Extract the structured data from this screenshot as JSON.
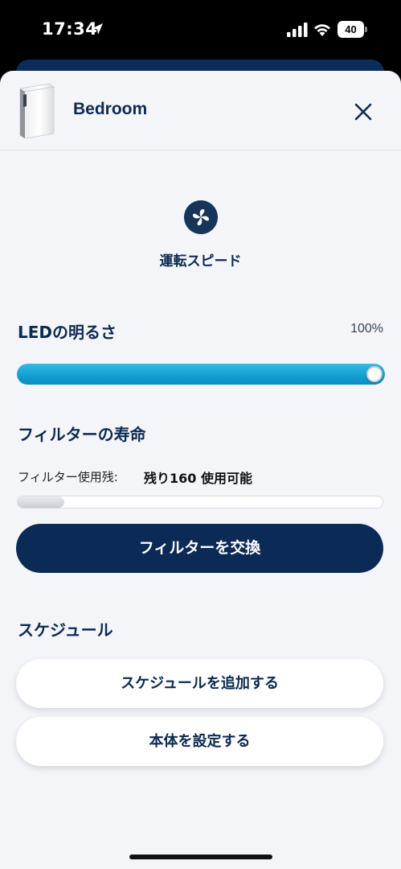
{
  "status_bar": {
    "time": "17:34",
    "battery": "40"
  },
  "header": {
    "device_name": "Bedroom"
  },
  "fan": {
    "label": "運転スピード",
    "icon": "fan-icon"
  },
  "led": {
    "title": "LEDの明るさ",
    "value": "100%",
    "level": 1.0
  },
  "filter": {
    "title": "フィルターの寿命",
    "remaining_label": "フィルター使用残:",
    "remaining_value": "残り160 使用可能",
    "replace_label": "フィルターを交換"
  },
  "schedule": {
    "title": "スケジュール",
    "add_label": "スケジュールを追加する",
    "settings_label": "本体を設定する"
  },
  "colors": {
    "navy": "#0b2a55",
    "accent_blue": "#14a0d2",
    "sheet_bg": "#f4f5f8"
  }
}
